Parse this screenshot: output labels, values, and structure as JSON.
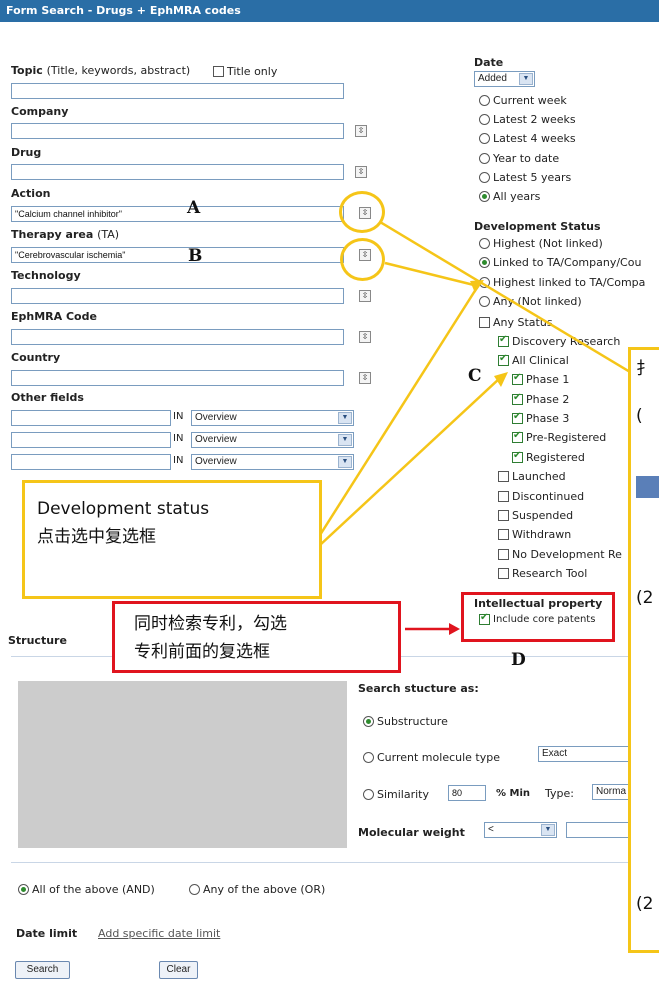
{
  "window": {
    "title": "Form Search - Drugs + EphMRA codes"
  },
  "form": {
    "topic_label": "Topic",
    "topic_sub": "(Title, keywords, abstract)",
    "title_only_label": "Title only",
    "company_label": "Company",
    "drug_label": "Drug",
    "action_label": "Action",
    "action_value": "\"Calcium channel inhibitor\"",
    "therapy_label": "Therapy area",
    "therapy_sub": "(TA)",
    "therapy_value": "\"Cerebrovascular ischemia\"",
    "technology_label": "Technology",
    "ephmra_label": "EphMRA Code",
    "country_label": "Country",
    "other_label": "Other fields",
    "other_in_label": "IN",
    "other_field_option": "Overview",
    "picker_icon": "picker-icon"
  },
  "date": {
    "label": "Date",
    "mode_select": "Added",
    "options": [
      "Current week",
      "Latest 2 weeks",
      "Latest 4 weeks",
      "Year to date",
      "Latest 5 years",
      "All years"
    ],
    "selected": "All years"
  },
  "dev_status": {
    "label": "Development Status",
    "radios": [
      "Highest (Not linked)",
      "Linked to TA/Company/Cou",
      "Highest linked to TA/Compa",
      "Any (Not linked)"
    ],
    "any_status": "Any Status",
    "items": [
      {
        "label": "Discovery Research",
        "checked": true
      },
      {
        "label": "All Clinical",
        "checked": true
      },
      {
        "label": "Phase 1",
        "checked": true
      },
      {
        "label": "Phase 2",
        "checked": true
      },
      {
        "label": "Phase 3",
        "checked": true
      },
      {
        "label": "Pre-Registered",
        "checked": true
      },
      {
        "label": "Registered",
        "checked": true
      },
      {
        "label": "Launched",
        "checked": false
      },
      {
        "label": "Discontinued",
        "checked": false
      },
      {
        "label": "Suspended",
        "checked": false
      },
      {
        "label": "Withdrawn",
        "checked": false
      },
      {
        "label": "No Development Re",
        "checked": false
      },
      {
        "label": "Research Tool",
        "checked": false
      }
    ]
  },
  "ip": {
    "label": "Intellectual property",
    "include_core_patents": "Include core patents"
  },
  "structure": {
    "label": "Structure",
    "search_as_label": "Search stucture as:",
    "substructure": "Substructure",
    "current_type": "Current molecule type",
    "current_type_value": "Exact",
    "similarity": "Similarity",
    "similarity_value": "80",
    "min_label": "% Min",
    "type_label": "Type:",
    "type_value": "Norma",
    "mol_weight_label": "Molecular weight",
    "mol_weight_op": "<"
  },
  "combine": {
    "and_label": "All of the above (AND)",
    "or_label": "Any of the above (OR)"
  },
  "date_limit": {
    "label": "Date limit",
    "link": "Add specific date limit"
  },
  "buttons": {
    "search": "Search",
    "clear": "Clear"
  },
  "annotations": {
    "marker_a": "A",
    "marker_b": "B",
    "marker_c": "C",
    "marker_d": "D",
    "dev_box_line1": "Development status",
    "dev_box_line2": "点击选中复选框",
    "patent_box_line1": "同时检索专利，勾选",
    "patent_box_line2": "专利前面的复选框",
    "right_box_t1": "扌",
    "right_box_t2": "(",
    "right_box_t3": "(2",
    "right_box_t4": "(2",
    "colors": {
      "yellow": "#f5c518",
      "red": "#e0141e",
      "accent_blue": "#2a6ea6"
    }
  }
}
